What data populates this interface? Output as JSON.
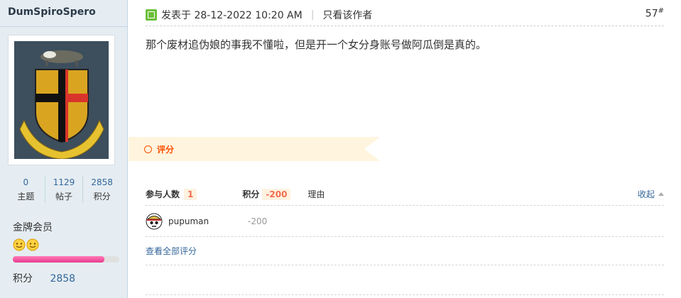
{
  "author": {
    "username": "DumSpiroSpero",
    "stats": [
      {
        "value": "0",
        "label": "主题"
      },
      {
        "value": "1129",
        "label": "帖子"
      },
      {
        "value": "2858",
        "label": "积分"
      }
    ],
    "group": "金牌会员",
    "credits_label": "积分",
    "credits_value": "2858",
    "progress": 0.86
  },
  "post": {
    "posted_label": "发表于 28-12-2022 10:20 AM",
    "only_author": "只看该作者",
    "floor": "57",
    "floor_suffix": "#",
    "content": "那个废材追伪娘的事我不懂啦，但是开一个女分身账号做阿瓜倒是真的。"
  },
  "rating": {
    "button_label": "评分",
    "participants_label": "参与人数",
    "participants_count": "1",
    "score_label": "积分",
    "score_total": "-200",
    "reason_label": "理由",
    "collapse_label": "收起",
    "rows": [
      {
        "user": "pupuman",
        "score": "-200",
        "reason": ""
      }
    ],
    "view_all": "查看全部评分"
  },
  "colors": {
    "sidebar_bg": "#e5edf2",
    "link": "#336699",
    "accent": "#ff4e00",
    "highlight": "#f26c4f",
    "progress": "#e83b8f"
  }
}
